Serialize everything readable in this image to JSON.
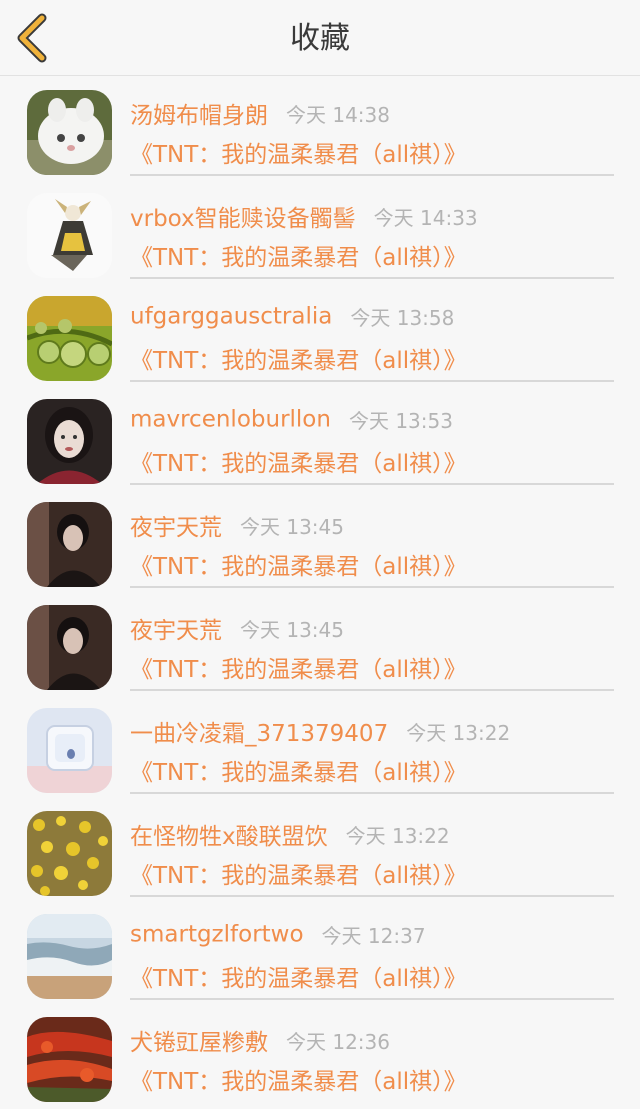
{
  "header": {
    "title": "收藏",
    "back_icon": "chevron-left-icon",
    "accent_color": "#f0b23a"
  },
  "colors": {
    "accent": "#f08d4b",
    "muted": "#b4b4b4",
    "background": "#f7f7f7"
  },
  "favorites": [
    {
      "name": "汤姆布帽身朗",
      "time": "今天 14:38",
      "book": "《TNT：我的温柔暴君（all祺）》",
      "avatar": "cat-photo"
    },
    {
      "name": "vrbox智能赎设备髑髻",
      "time": "今天 14:33",
      "book": "《TNT：我的温柔暴君（all祺）》",
      "avatar": "anime-figure"
    },
    {
      "name": "ufgarggausctralia",
      "time": "今天 13:58",
      "book": "《TNT：我的温柔暴君（all祺）》",
      "avatar": "water-drops"
    },
    {
      "name": "mavrcenloburllon",
      "time": "今天 13:53",
      "book": "《TNT：我的温柔暴君（all祺）》",
      "avatar": "girl-portrait"
    },
    {
      "name": "夜宇天荒",
      "time": "今天 13:45",
      "book": "《TNT：我的温柔暴君（all祺）》",
      "avatar": "dark-portrait"
    },
    {
      "name": "夜宇天荒",
      "time": "今天 13:45",
      "book": "《TNT：我的温柔暴君（all祺）》",
      "avatar": "dark-portrait"
    },
    {
      "name": "一曲冷凌霜_371379407",
      "time": "今天 13:22",
      "book": "《TNT：我的温柔暴君（all祺）》",
      "avatar": "ice-cube"
    },
    {
      "name": "在怪物牲x酸联盟饮",
      "time": "今天 13:22",
      "book": "《TNT：我的温柔暴君（all祺）》",
      "avatar": "yellow-flowers"
    },
    {
      "name": "smartgzlfortwo",
      "time": "今天 12:37",
      "book": "《TNT：我的温柔暴君（all祺）》",
      "avatar": "beach-waves"
    },
    {
      "name": "犬锩豇屋糁敷",
      "time": "今天 12:36",
      "book": "《TNT：我的温柔暴君（all祺）》",
      "avatar": "red-flowers"
    }
  ]
}
